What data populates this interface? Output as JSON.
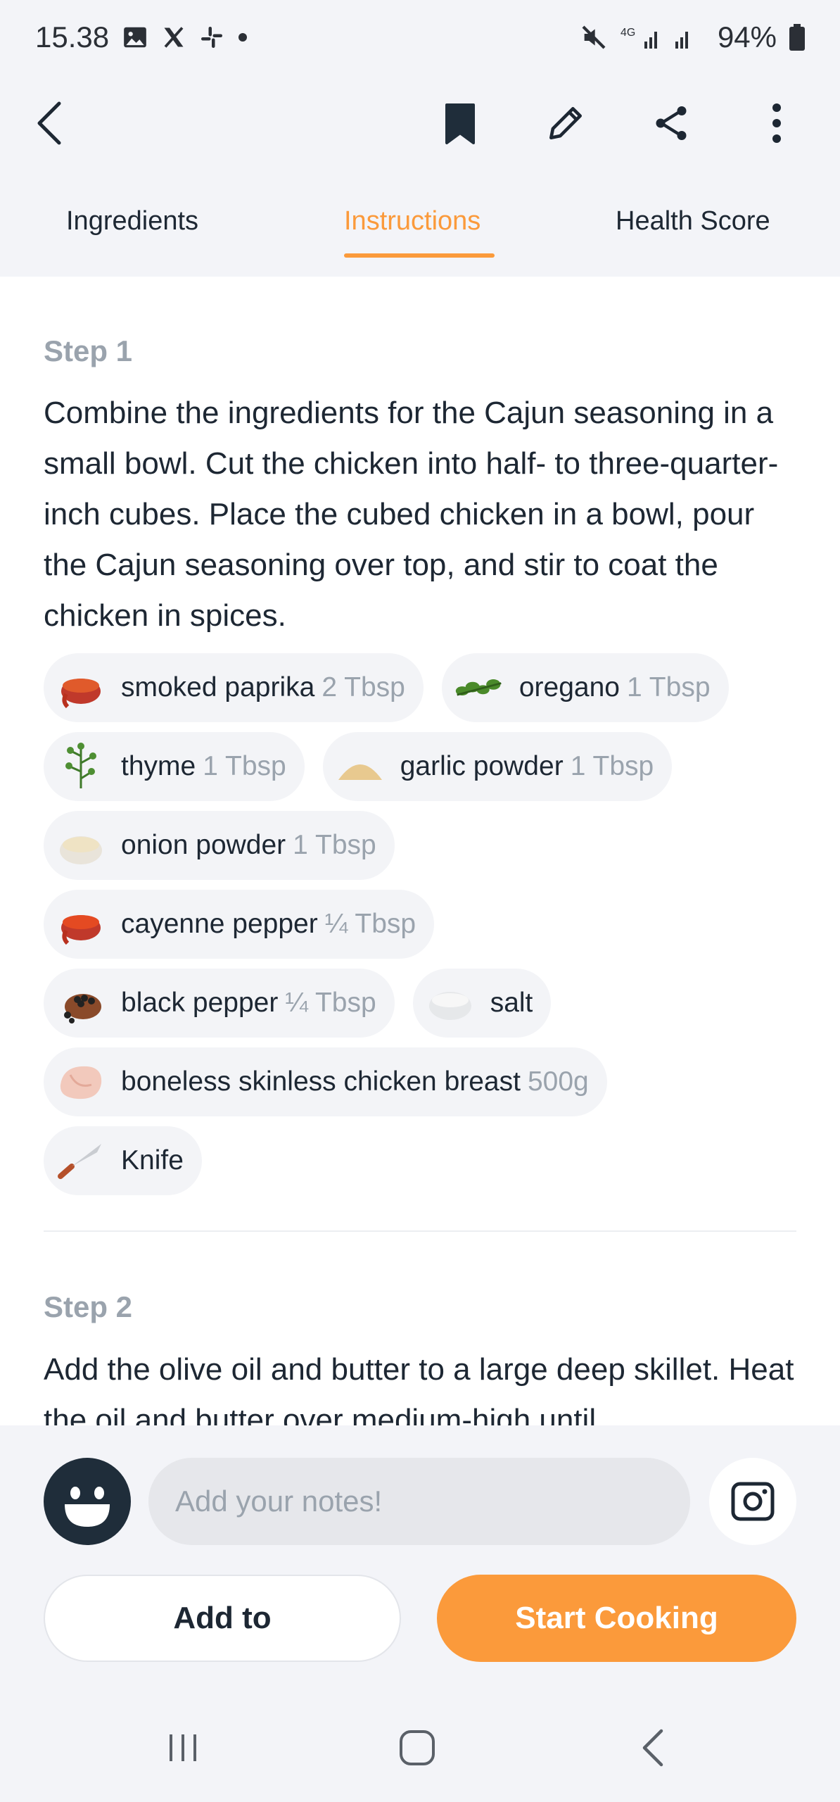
{
  "status_bar": {
    "time": "15.38",
    "battery": "94%",
    "network": "4G"
  },
  "tabs": [
    {
      "label": "Ingredients"
    },
    {
      "label": "Instructions",
      "active": true
    },
    {
      "label": "Health Score"
    }
  ],
  "steps": [
    {
      "title": "Step 1",
      "text": "Combine the ingredients for the Cajun seasoning in a small bowl. Cut the chicken into half- to three-quarter-inch cubes. Place the cubed chicken in a bowl, pour the Cajun seasoning over top, and stir to coat the chicken in spices."
    },
    {
      "title": "Step 2",
      "text": "Add the olive oil and butter to a large deep skillet. Heat the oil and butter over medium-high until"
    }
  ],
  "ingredients": {
    "paprika": {
      "name": "smoked paprika",
      "qty": "2 Tbsp"
    },
    "oregano": {
      "name": "oregano",
      "qty": "1 Tbsp"
    },
    "thyme": {
      "name": "thyme",
      "qty": "1 Tbsp"
    },
    "garlic": {
      "name": "garlic powder",
      "qty": "1 Tbsp"
    },
    "onion": {
      "name": "onion powder",
      "qty": "1 Tbsp"
    },
    "cayenne": {
      "name": "cayenne pepper",
      "qty": "¼ Tbsp"
    },
    "black_pepper": {
      "name": "black pepper",
      "qty": "¼ Tbsp"
    },
    "salt": {
      "name": "salt",
      "qty": ""
    },
    "chicken": {
      "name": "boneless skinless chicken breast",
      "qty": "500g"
    },
    "knife": {
      "name": "Knife",
      "qty": ""
    }
  },
  "notes": {
    "placeholder": "Add your notes!"
  },
  "buttons": {
    "add_to": "Add to",
    "start_cooking": "Start Cooking"
  },
  "colors": {
    "accent": "#fb9a3b",
    "dark": "#1f2d3a",
    "muted": "#9aa3ad"
  }
}
